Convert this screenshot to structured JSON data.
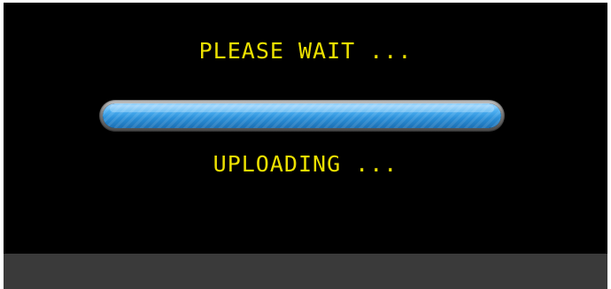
{
  "dialog": {
    "title": "PLEASE WAIT ...",
    "status": "UPLOADING ...",
    "progress_fraction": 1.0
  },
  "colors": {
    "background": "#000000",
    "text": "#ece000",
    "progress_fill": "#2a8fd8",
    "bottom_bar": "#3a3a3a"
  }
}
